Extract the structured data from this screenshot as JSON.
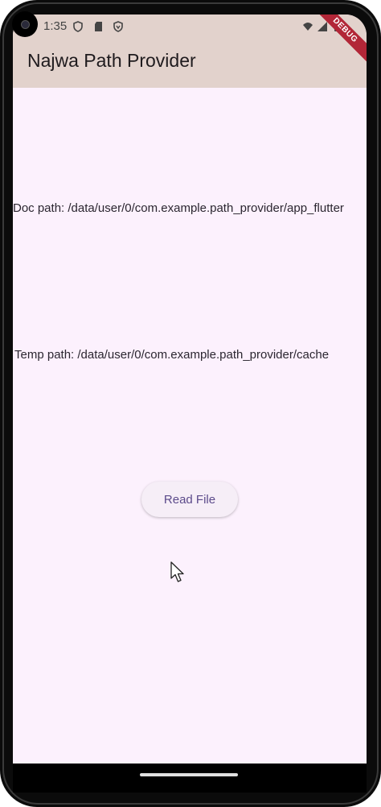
{
  "status_bar": {
    "time": "1:35"
  },
  "app_bar": {
    "title": "Najwa Path Provider",
    "debug_banner": "DEBUG",
    "color": "#e2d2cc"
  },
  "body": {
    "doc_path": "Doc path: /data/user/0/com.example.path_provider/app_flutter",
    "temp_path": "Temp path: /data/user/0/com.example.path_provider/cache",
    "read_button_label": "Read File"
  },
  "colors": {
    "background": "#fcf1fd",
    "button_text": "#5b4a8a",
    "debug": "#b22637"
  }
}
